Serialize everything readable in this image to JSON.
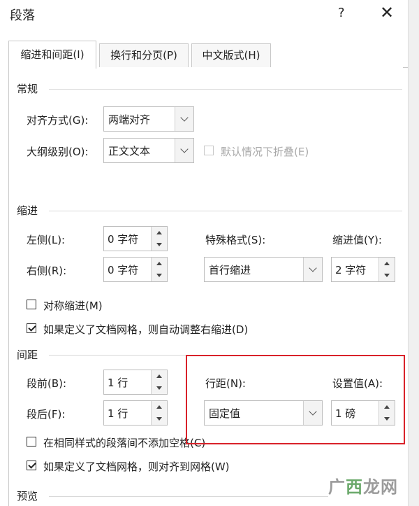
{
  "dialog": {
    "title": "段落",
    "help": "?",
    "close": "✕"
  },
  "tabs": [
    {
      "label": "缩进和间距(I)",
      "active": true
    },
    {
      "label": "换行和分页(P)",
      "active": false
    },
    {
      "label": "中文版式(H)",
      "active": false
    }
  ],
  "general": {
    "header": "常规",
    "alignment": {
      "label": "对齐方式(G):",
      "value": "两端对齐"
    },
    "outline": {
      "label": "大纲级别(O):",
      "value": "正文文本"
    },
    "collapse": {
      "label": "默认情况下折叠(E)",
      "checked": false,
      "enabled": false
    }
  },
  "indent": {
    "header": "缩进",
    "left": {
      "label": "左侧(L):",
      "value": "0 字符"
    },
    "right": {
      "label": "右侧(R):",
      "value": "0 字符"
    },
    "special": {
      "label": "特殊格式(S):",
      "value": "首行缩进"
    },
    "by": {
      "label": "缩进值(Y):",
      "value": "2 字符"
    },
    "mirror": {
      "label": "对称缩进(M)",
      "checked": false
    },
    "auto_adjust": {
      "label": "如果定义了文档网格，则自动调整右缩进(D)",
      "checked": true
    }
  },
  "spacing": {
    "header": "间距",
    "before": {
      "label": "段前(B):",
      "value": "1 行"
    },
    "after": {
      "label": "段后(F):",
      "value": "1 行"
    },
    "line_spacing": {
      "label": "行距(N):",
      "value": "固定值"
    },
    "at": {
      "label": "设置值(A):",
      "value": "1 磅"
    },
    "no_space_same_style": {
      "label": "在相同样式的段落间不添加空格(C)",
      "checked": false
    },
    "snap_to_grid": {
      "label": "如果定义了文档网格，则对齐到网格(W)",
      "checked": true
    }
  },
  "preview": {
    "header": "预览"
  },
  "watermark": {
    "a": "广",
    "b": "西",
    "c": "龙网"
  },
  "colors": {
    "highlight": "#d9222a"
  }
}
